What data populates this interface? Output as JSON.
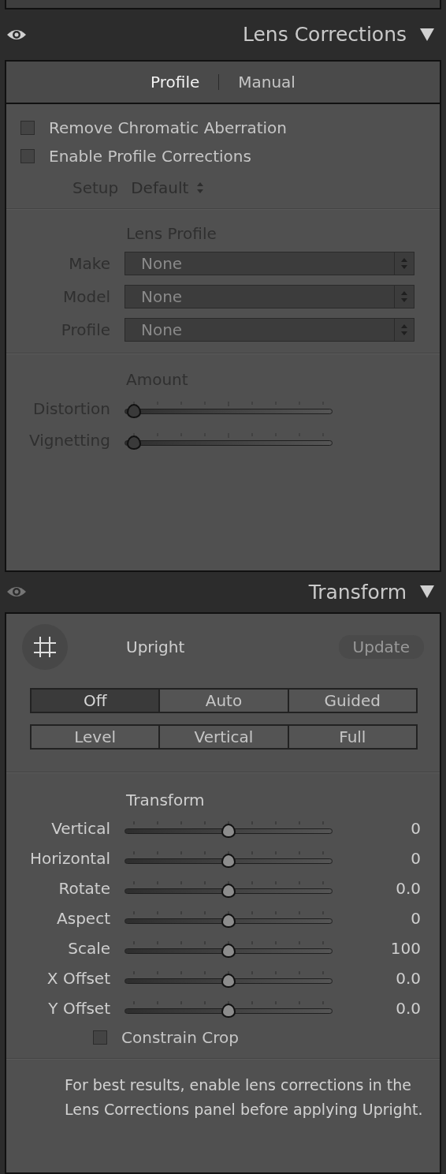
{
  "lens_corrections": {
    "title": "Lens Corrections",
    "visible": true,
    "tabs": [
      {
        "label": "Profile",
        "selected": true
      },
      {
        "label": "Manual",
        "selected": false
      }
    ],
    "checkboxes": [
      {
        "label": "Remove Chromatic Aberration",
        "checked": false
      },
      {
        "label": "Enable Profile Corrections",
        "checked": false
      }
    ],
    "setup": {
      "label": "Setup",
      "value": "Default"
    },
    "lens_profile": {
      "title": "Lens Profile",
      "disabled": true,
      "fields": [
        {
          "label": "Make",
          "value": "None"
        },
        {
          "label": "Model",
          "value": "None"
        },
        {
          "label": "Profile",
          "value": "None"
        }
      ]
    },
    "amount": {
      "title": "Amount",
      "disabled": true,
      "sliders": [
        {
          "label": "Distortion",
          "level": 0
        },
        {
          "label": "Vignetting",
          "level": 0
        }
      ]
    }
  },
  "transform": {
    "title": "Transform",
    "visible": false,
    "upright_label": "Upright",
    "update_button": "Update",
    "upright_modes": [
      {
        "label": "Off",
        "selected": true
      },
      {
        "label": "Auto",
        "selected": false
      },
      {
        "label": "Guided",
        "selected": false
      },
      {
        "label": "Level",
        "selected": false
      },
      {
        "label": "Vertical",
        "selected": false
      },
      {
        "label": "Full",
        "selected": false
      }
    ],
    "section_title": "Transform",
    "disabled": false,
    "sliders": [
      {
        "label": "Vertical",
        "level": 0.5,
        "reading": "0"
      },
      {
        "label": "Horizontal",
        "level": 0.5,
        "reading": "0"
      },
      {
        "label": "Rotate",
        "level": 0.5,
        "reading": "0.0"
      },
      {
        "label": "Aspect",
        "level": 0.5,
        "reading": "0"
      },
      {
        "label": "Scale",
        "level": 0.5,
        "reading": "100"
      },
      {
        "label": "X Offset",
        "level": 0.5,
        "reading": "0.0"
      },
      {
        "label": "Y Offset",
        "level": 0.5,
        "reading": "0.0"
      }
    ],
    "constrain_crop": {
      "label": "Constrain Crop",
      "checked": false
    },
    "note": "For best results, enable lens corrections in the Lens Corrections panel before applying Upright."
  }
}
